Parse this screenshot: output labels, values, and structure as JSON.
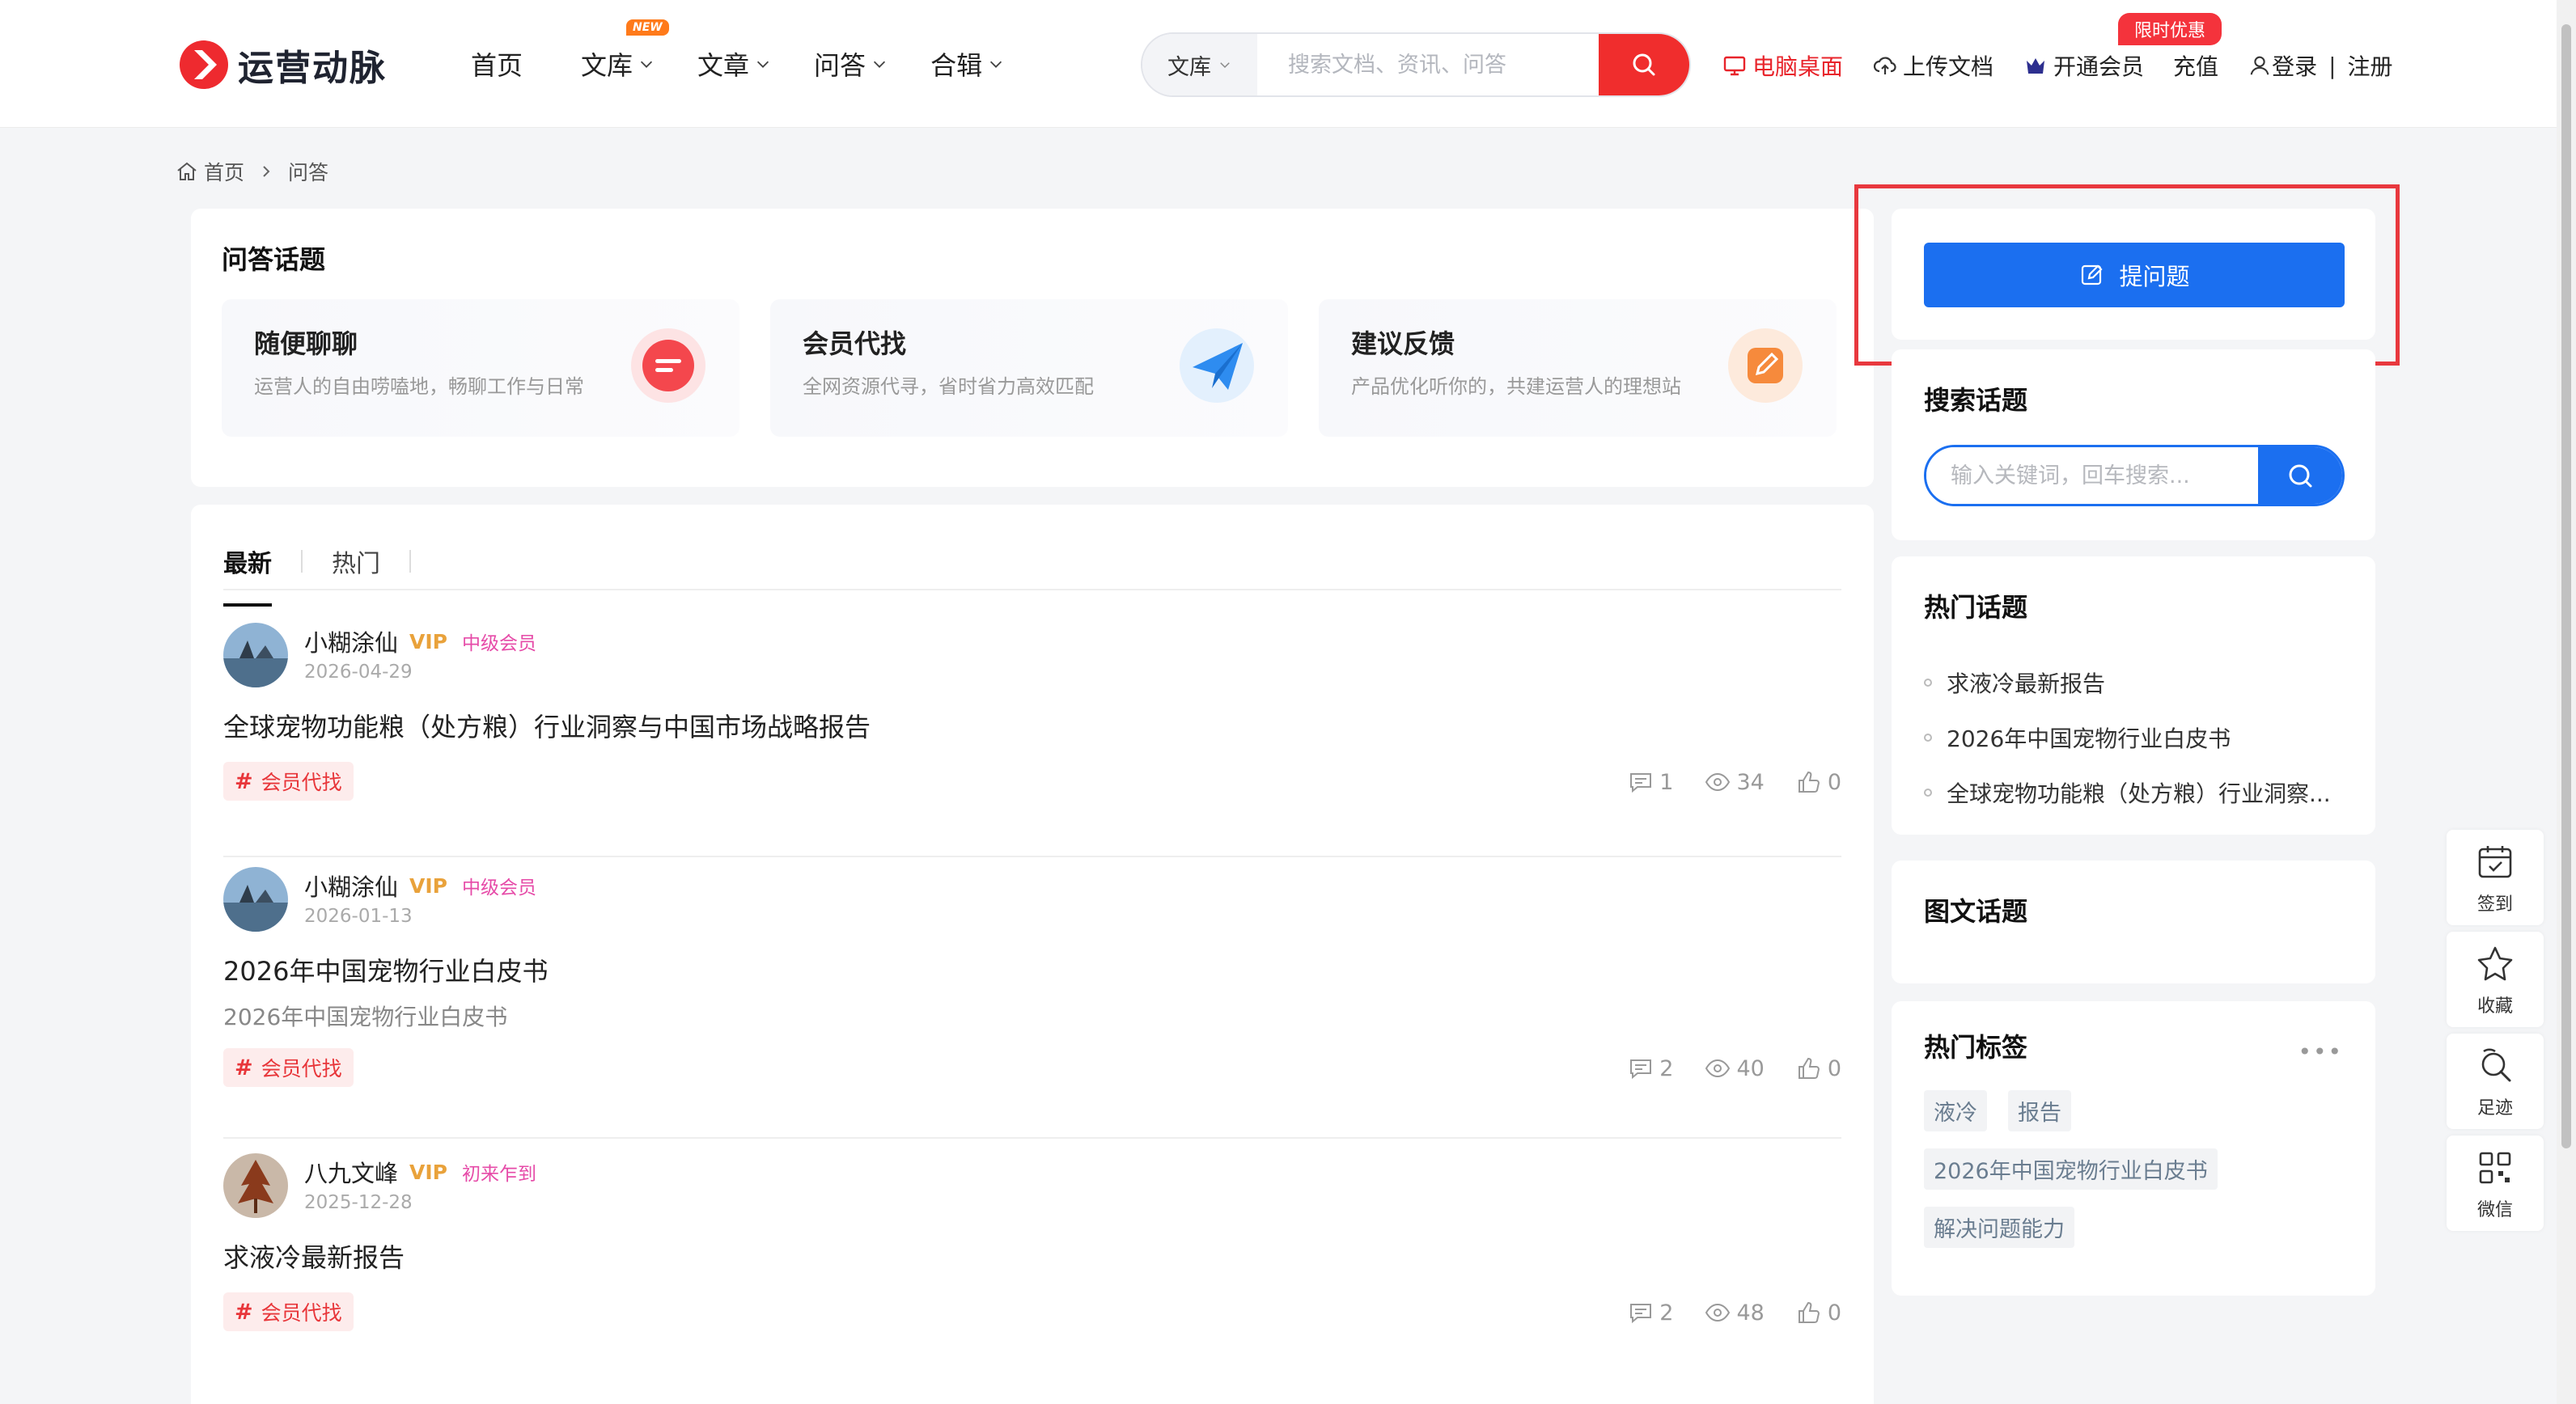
{
  "header": {
    "logo_text": "运营动脉",
    "nav": [
      {
        "label": "首页",
        "has_dropdown": false
      },
      {
        "label": "文库",
        "has_dropdown": true,
        "badge": "NEW"
      },
      {
        "label": "文章",
        "has_dropdown": true
      },
      {
        "label": "问答",
        "has_dropdown": true
      },
      {
        "label": "合辑",
        "has_dropdown": true
      }
    ],
    "search": {
      "category": "文库",
      "placeholder": "搜索文档、资讯、问答"
    },
    "desktop_label": "电脑桌面",
    "upload_label": "上传文档",
    "vip_label": "开通会员",
    "recharge_label": "充值",
    "promo_badge": "限时优惠",
    "login_label": "登录",
    "separator": "|",
    "register_label": "注册"
  },
  "breadcrumb": {
    "home": "首页",
    "current": "问答"
  },
  "topics": {
    "title": "问答话题",
    "items": [
      {
        "name": "随便聊聊",
        "desc": "运营人的自由唠嗑地，畅聊工作与日常",
        "icon": "chat-bubble-icon",
        "color": "#f4474d"
      },
      {
        "name": "会员代找",
        "desc": "全网资源代寻，省时省力高效匹配",
        "icon": "paper-plane-icon",
        "color": "#2e8cf0"
      },
      {
        "name": "建议反馈",
        "desc": "产品优化听你的，共建运营人的理想站",
        "icon": "edit-icon",
        "color": "#f68a3c"
      }
    ]
  },
  "feed": {
    "tabs": [
      "最新",
      "热门"
    ],
    "posts": [
      {
        "author": "小糊涂仙",
        "vip": "VIP",
        "level": "中级会员",
        "date": "2026-04-29",
        "title": "全球宠物功能粮（处方粮）行业洞察与中国市场战略报告",
        "subtitle": "",
        "tag": "会员代找",
        "comments": "1",
        "views": "34",
        "likes": "0"
      },
      {
        "author": "小糊涂仙",
        "vip": "VIP",
        "level": "中级会员",
        "date": "2026-01-13",
        "title": "2026年中国宠物行业白皮书",
        "subtitle": "2026年中国宠物行业白皮书",
        "tag": "会员代找",
        "comments": "2",
        "views": "40",
        "likes": "0"
      },
      {
        "author": "八九文峰",
        "vip": "VIP",
        "level": "初来乍到",
        "date": "2025-12-28",
        "title": "求液冷最新报告",
        "subtitle": "",
        "tag": "会员代找",
        "comments": "2",
        "views": "48",
        "likes": "0"
      }
    ]
  },
  "sidebar": {
    "ask_label": "提问题",
    "search_title": "搜索话题",
    "search_placeholder": "输入关键词，回车搜索...",
    "hot_title": "热门话题",
    "hot_items": [
      "求液冷最新报告",
      "2026年中国宠物行业白皮书",
      "全球宠物功能粮（处方粮）行业洞察..."
    ],
    "pic_title": "图文话题",
    "tags_title": "热门标签",
    "more": "•••",
    "tags": [
      "液冷",
      "报告",
      "2026年中国宠物行业白皮书",
      "解决问题能力"
    ]
  },
  "rail": [
    {
      "label": "签到",
      "icon": "calendar-check-icon"
    },
    {
      "label": "收藏",
      "icon": "star-icon"
    },
    {
      "label": "足迹",
      "icon": "footprint-search-icon"
    },
    {
      "label": "微信",
      "icon": "qrcode-icon"
    }
  ],
  "colors": {
    "brand_red": "#f02d2d",
    "primary_blue": "#1b6ff0",
    "vip_gold": "#e9a23b",
    "level_pink": "#e64ba8"
  }
}
